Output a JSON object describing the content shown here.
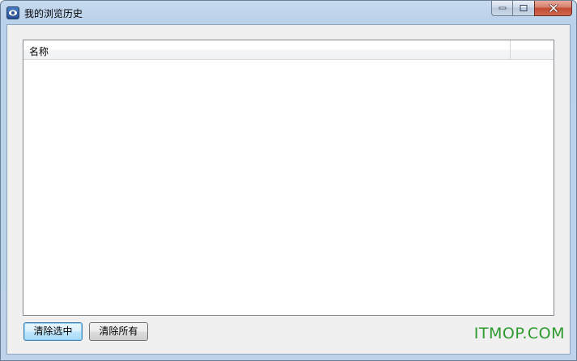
{
  "window": {
    "title": "我的浏览历史",
    "icon": "browser-app-icon"
  },
  "caption_buttons": {
    "minimize_icon": "minimize-icon",
    "maximize_icon": "maximize-icon",
    "close_icon": "close-icon"
  },
  "list": {
    "columns": [
      {
        "label": "名称"
      },
      {
        "label": ""
      }
    ],
    "rows": []
  },
  "buttons": {
    "clear_selected": "清除选中",
    "clear_all": "清除所有"
  },
  "watermark": "ITMOP.COM",
  "colors": {
    "watermark": "#2e9a2e",
    "default_button_border": "#3c7fb1",
    "close_button": "#c14a33"
  }
}
